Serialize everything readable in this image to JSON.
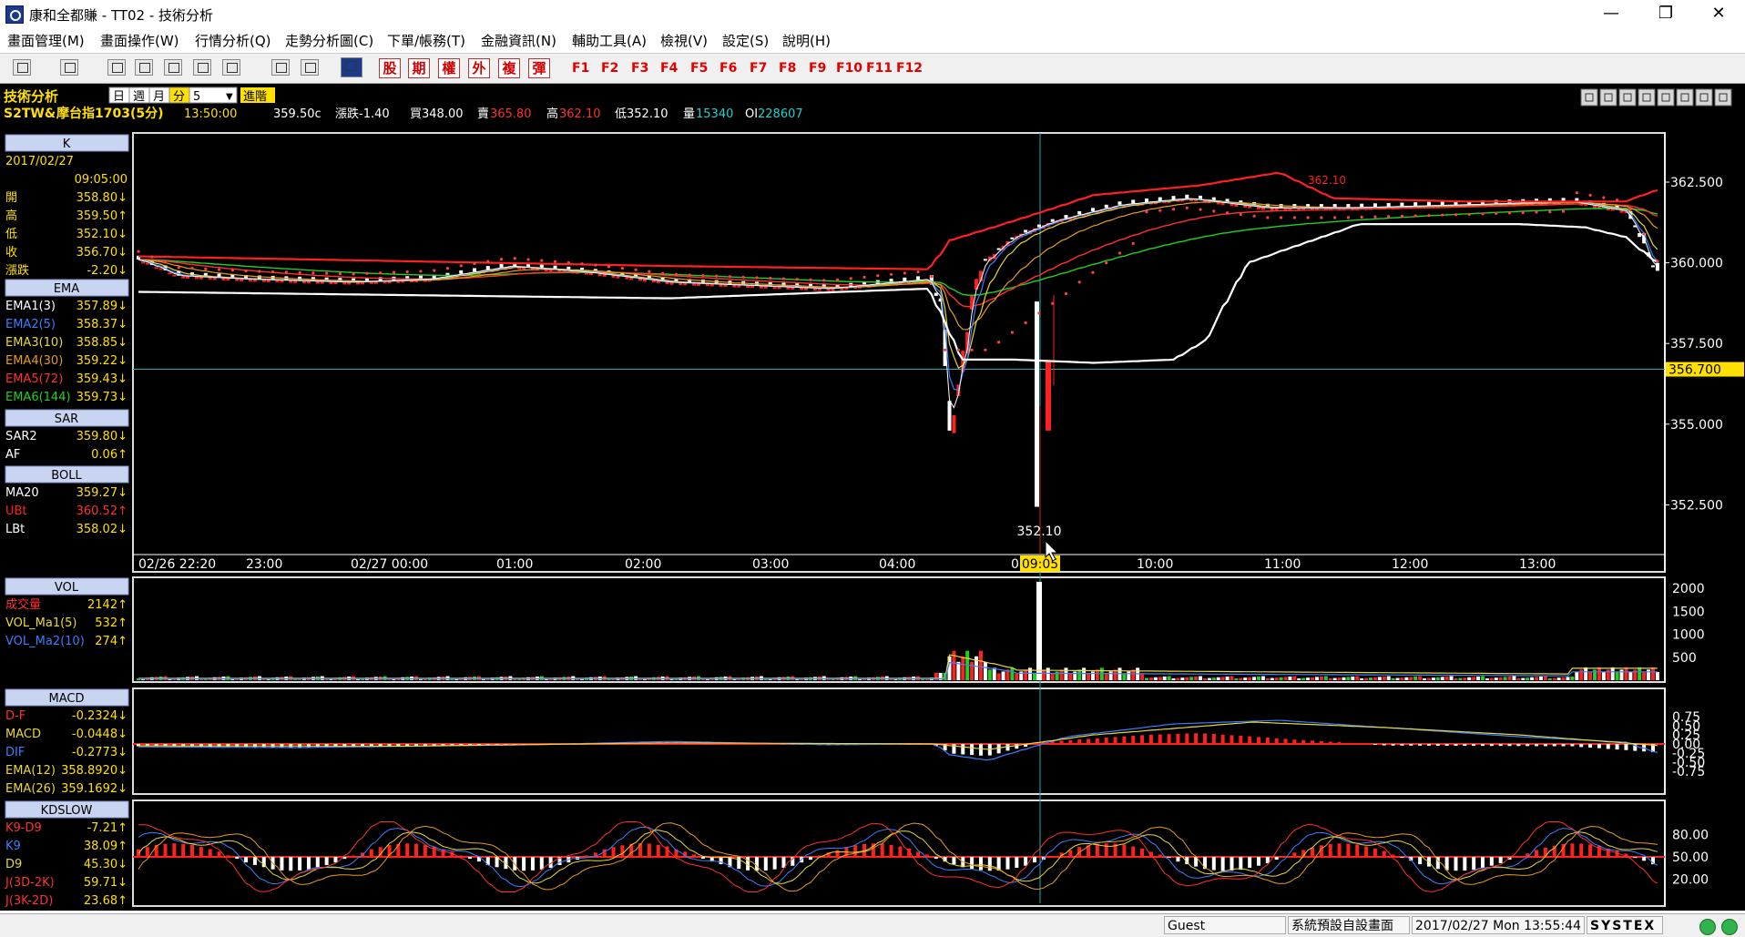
{
  "window": {
    "title": "康和全都賺 - TT02 - 技術分析",
    "min_label": "—",
    "max_label": "❐",
    "close_label": "✕"
  },
  "menu": [
    "畫面管理(M)",
    "畫面操作(W)",
    "行情分析(Q)",
    "走勢分析圖(C)",
    "下單/帳務(T)",
    "金融資訊(N)",
    "輔助工具(A)",
    "檢視(V)",
    "設定(S)",
    "說明(H)"
  ],
  "toolbar": {
    "red_buttons": [
      "股",
      "期",
      "權",
      "外",
      "複",
      "彈"
    ],
    "fkeys": [
      "F1",
      "F2",
      "F3",
      "F4",
      "F5",
      "F6",
      "F7",
      "F8",
      "F9",
      "F10",
      "F11",
      "F12"
    ]
  },
  "header": {
    "label": "技術分析",
    "periods": [
      "日",
      "週",
      "月",
      "分"
    ],
    "period_value": "5",
    "advanced": "進階",
    "symbol": "S2TW&",
    "name": "摩台指1703(5分)",
    "time": "13:50:00",
    "price": "359.50c",
    "change": "漲跌-1.40",
    "bid": "買348.00",
    "ask_label": "賣",
    "ask": "365.80",
    "high_label": "高",
    "high": "362.10",
    "low": "低352.10",
    "vol_label": "量",
    "vol": "15340",
    "oi_label": "OI",
    "oi": "228607"
  },
  "panel": {
    "k": {
      "title": "K",
      "date": "2017/02/27",
      "time": "09:05:00",
      "rows": [
        {
          "label": "開",
          "value": "358.80↓"
        },
        {
          "label": "高",
          "value": "359.50↑"
        },
        {
          "label": "低",
          "value": "352.10↓"
        },
        {
          "label": "收",
          "value": "356.70↓"
        },
        {
          "label": "漲跌",
          "value": "-2.20↓"
        }
      ]
    },
    "ema": {
      "title": "EMA",
      "rows": [
        {
          "label": "EMA1(3)",
          "value": "357.89↓",
          "color": "#ffffff"
        },
        {
          "label": "EMA2(5)",
          "value": "358.37↓",
          "color": "#3a7fff"
        },
        {
          "label": "EMA3(10)",
          "value": "358.85↓",
          "color": "#e8d838"
        },
        {
          "label": "EMA4(30)",
          "value": "359.22↓",
          "color": "#e89a20"
        },
        {
          "label": "EMA5(72)",
          "value": "359.43↓",
          "color": "#ff3030"
        },
        {
          "label": "EMA6(144)",
          "value": "359.73↓",
          "color": "#20d020"
        }
      ]
    },
    "sar": {
      "title": "SAR",
      "rows": [
        {
          "label": "SAR2",
          "value": "359.80↓",
          "color": "#ffffff"
        },
        {
          "label": "AF",
          "value": "0.06↑",
          "color": "#ffffff"
        }
      ]
    },
    "boll": {
      "title": "BOLL",
      "rows": [
        {
          "label": "MA20",
          "value": "359.27↓",
          "color": "#ffffff"
        },
        {
          "label": "UBt",
          "value": "360.52↑",
          "color": "#ff2020"
        },
        {
          "label": "LBt",
          "value": "358.02↓",
          "color": "#ffffff"
        }
      ]
    },
    "vol": {
      "title": "VOL",
      "rows": [
        {
          "label": "成交量",
          "value": "2142↑",
          "color": "#ff3030"
        },
        {
          "label": "VOL_Ma1(5)",
          "value": "532↑",
          "color": "#e8d838"
        },
        {
          "label": "VOL_Ma2(10)",
          "value": "274↑",
          "color": "#3a7fff"
        }
      ]
    },
    "macd": {
      "title": "MACD",
      "rows": [
        {
          "label": "D-F",
          "value": "-0.2324↓",
          "color": "#ff3030"
        },
        {
          "label": "MACD",
          "value": "-0.0448↓",
          "color": "#e8d838"
        },
        {
          "label": "DIF",
          "value": "-0.2773↓",
          "color": "#3a7fff"
        },
        {
          "label": "EMA(12)",
          "value": "358.8920↓",
          "color": "#e8d838"
        },
        {
          "label": "EMA(26)",
          "value": "359.1692↓",
          "color": "#e8d838"
        }
      ]
    },
    "kd": {
      "title": "KDSLOW",
      "rows": [
        {
          "label": "K9-D9",
          "value": "-7.21↑",
          "color": "#ff3030"
        },
        {
          "label": "K9",
          "value": "38.09↑",
          "color": "#3a7fff"
        },
        {
          "label": "D9",
          "value": "45.30↓",
          "color": "#e8d838"
        },
        {
          "label": "J(3D-2K)",
          "value": "59.71↓",
          "color": "#ff3030"
        },
        {
          "label": "J(3K-2D)",
          "value": "23.68↑",
          "color": "#ff3030"
        }
      ]
    }
  },
  "axes": {
    "price_ticks": [
      "362.500",
      "360.000",
      "357.500",
      "355.000",
      "352.500"
    ],
    "price_marker": "356.700",
    "cursor_low_label": "352.10",
    "time_ticks": [
      "02/26 22:20",
      "23:00",
      "02/27 00:00",
      "01:00",
      "02:00",
      "03:00",
      "04:00",
      "10:00",
      "11:00",
      "12:00",
      "13:00"
    ],
    "cursor_time_label": "09:05",
    "cursor_time_prefix": "0",
    "ubt_label": "362.10",
    "vol_ticks": [
      "2000",
      "1500",
      "1000",
      "500"
    ],
    "macd_ticks": [
      "0.75",
      "0.50",
      "0.25",
      "0.00",
      "-0.25",
      "-0.50",
      "-0.75"
    ],
    "kd_ticks": [
      "80.00",
      "50.00",
      "20.00"
    ]
  },
  "status": {
    "user": "Guest",
    "layout": "系統預設自設畫面",
    "datetime": "2017/02/27 Mon 13:55:44",
    "brand": "SYSTEX"
  },
  "colors": {
    "background": "#000000",
    "up": "#ff2020",
    "down": "#ffffff",
    "cursor": "#20b0b0",
    "marker_bg": "#ffe000"
  }
}
